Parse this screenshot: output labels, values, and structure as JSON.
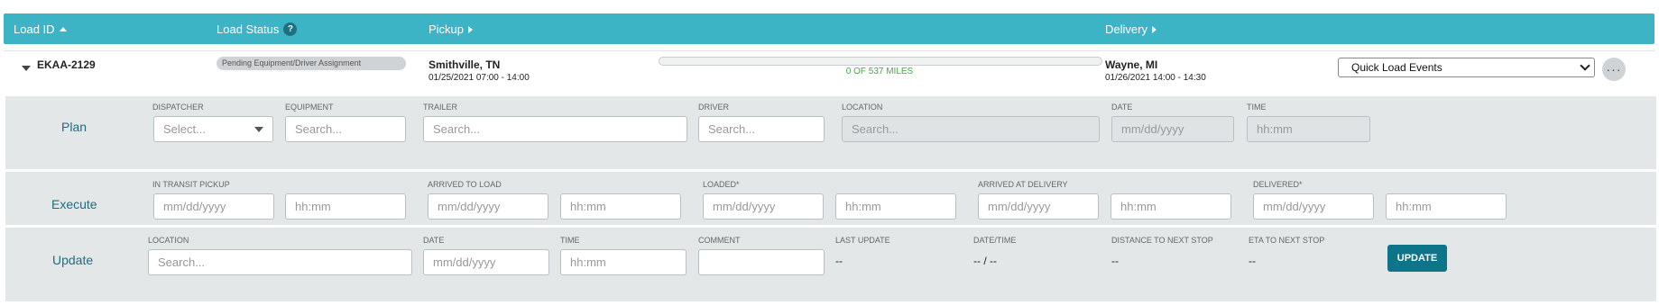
{
  "header": {
    "load_id": "Load ID",
    "load_status": "Load Status",
    "help_glyph": "?",
    "pickup": "Pickup",
    "delivery": "Delivery"
  },
  "load": {
    "id": "EKAA-2129",
    "status": "Pending Equipment/Driver Assignment",
    "pickup_city": "Smithville, TN",
    "pickup_time": "01/25/2021 07:00 - 14:00",
    "progress_text": "0 OF 537 MILES",
    "progress_fraction": 0,
    "delivery_city": "Wayne, MI",
    "delivery_time": "01/26/2021 14:00 - 14:30",
    "quick_events": "Quick Load Events",
    "more_glyph": "···"
  },
  "plan": {
    "title": "Plan",
    "dispatcher_label": "DISPATCHER",
    "dispatcher_placeholder": "Select...",
    "equipment_label": "EQUIPMENT",
    "equipment_placeholder": "Search...",
    "trailer_label": "TRAILER",
    "trailer_placeholder": "Search...",
    "driver_label": "DRIVER",
    "driver_placeholder": "Search...",
    "location_label": "LOCATION",
    "location_placeholder": "Search...",
    "date_label": "DATE",
    "date_placeholder": "mm/dd/yyyy",
    "time_label": "TIME",
    "time_placeholder": "hh:mm"
  },
  "execute": {
    "title": "Execute",
    "in_transit_label": "IN TRANSIT PICKUP",
    "arrived_load_label": "ARRIVED TO LOAD",
    "loaded_label": "LOADED*",
    "arrived_delivery_label": "ARRIVED AT DELIVERY",
    "delivered_label": "DELIVERED*",
    "date_placeholder": "mm/dd/yyyy",
    "time_placeholder": "hh:mm"
  },
  "update": {
    "title": "Update",
    "location_label": "LOCATION",
    "location_placeholder": "Search...",
    "date_label": "DATE",
    "date_placeholder": "mm/dd/yyyy",
    "time_label": "TIME",
    "time_placeholder": "hh:mm",
    "comment_label": "COMMENT",
    "last_update_label": "LAST UPDATE",
    "last_update_value": "--",
    "datetime_label": "DATE/TIME",
    "datetime_value": "-- / --",
    "distance_label": "DISTANCE TO NEXT STOP",
    "distance_value": "--",
    "eta_label": "ETA TO NEXT STOP",
    "eta_value": "--",
    "button": "UPDATE"
  },
  "colors": {
    "header": "#3db3c6",
    "section_bg": "#e3e7e8",
    "accent": "#0e7489",
    "progress_text": "#4aa84a"
  }
}
